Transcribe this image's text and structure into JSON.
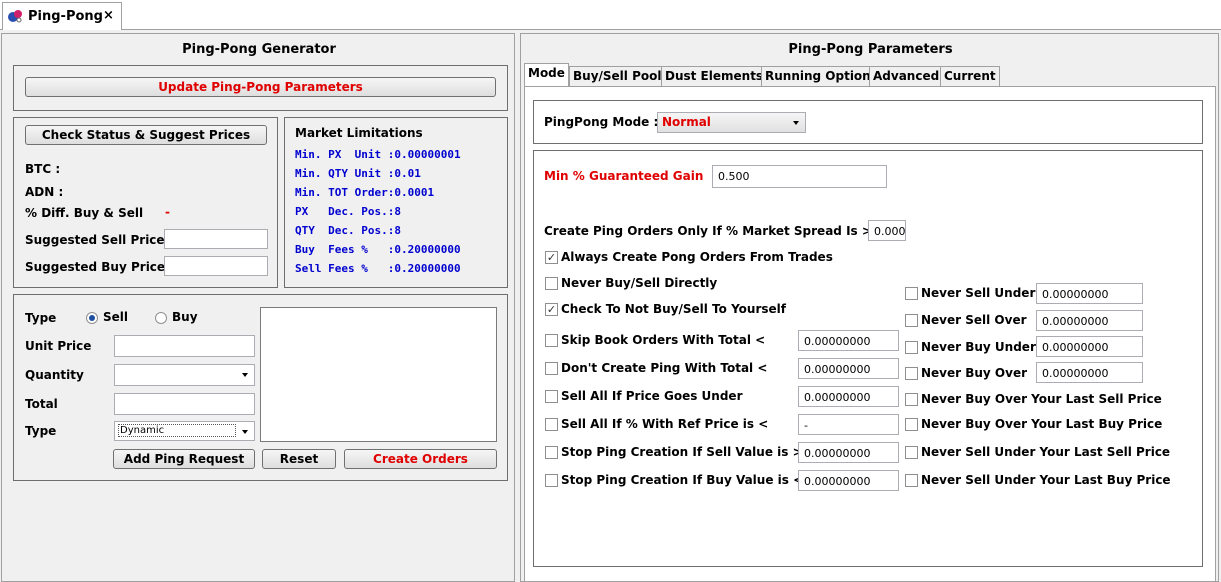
{
  "window": {
    "tab_title": "Ping-Pong",
    "tab_close": "×"
  },
  "generator": {
    "title": "Ping-Pong Generator",
    "update_button": "Update Ping-Pong Parameters",
    "check_status_button": "Check Status & Suggest Prices",
    "btc_label": "BTC :",
    "adn_label": "ADN :",
    "diff_label": "% Diff. Buy & Sell",
    "diff_value": "-",
    "suggested_sell_label": "Suggested Sell Price",
    "suggested_buy_label": "Suggested Buy Price",
    "market": {
      "title": "Market Limitations",
      "lines": [
        "Min. PX  Unit :0.00000001",
        "Min. QTY Unit :0.01",
        "Min. TOT Order:0.0001",
        "PX   Dec. Pos.:8",
        "QTY  Dec. Pos.:8",
        "Buy  Fees %   :0.20000000",
        "Sell Fees %   :0.20000000"
      ]
    },
    "order": {
      "type_label": "Type",
      "sell_label": "Sell",
      "buy_label": "Buy",
      "unit_price_label": "Unit Price",
      "quantity_label": "Quantity",
      "total_label": "Total",
      "type2_label": "Type",
      "type2_value": "Dynamic",
      "add_button": "Add Ping Request",
      "reset_button": "Reset",
      "create_button": "Create Orders"
    }
  },
  "params": {
    "title": "Ping-Pong Parameters",
    "tabs": [
      "Mode",
      "Buy/Sell Pool",
      "Dust Elements",
      "Running Option",
      "Advanced",
      "Current"
    ],
    "mode_label": "PingPong Mode :",
    "mode_value": "Normal",
    "min_gain_label": "Min % Guaranteed Gain",
    "min_gain_value": "0.500",
    "spread_label": "Create Ping Orders Only If % Market Spread Is >",
    "spread_value": "0.000",
    "left_checks": [
      {
        "label": "Always Create Pong Orders From Trades",
        "checked": "✓"
      },
      {
        "label": "Never Buy/Sell Directly",
        "checked": ""
      },
      {
        "label": "Check To Not Buy/Sell To Yourself",
        "checked": "✓"
      },
      {
        "label": "Skip Book Orders With Total <",
        "checked": "",
        "value": "0.00000000"
      },
      {
        "label": "Don't Create Ping With Total <",
        "checked": "",
        "value": "0.00000000"
      },
      {
        "label": "Sell All If Price Goes Under",
        "checked": "",
        "value": "0.00000000"
      },
      {
        "label": "Sell All If % With Ref Price is <",
        "checked": "",
        "value": "-"
      },
      {
        "label": "Stop Ping Creation If Sell Value is >",
        "checked": "",
        "value": "0.00000000"
      },
      {
        "label": "Stop Ping Creation If Buy Value is <",
        "checked": "",
        "value": "0.00000000"
      }
    ],
    "right_checks": [
      {
        "label": "Never Sell Under",
        "value": "0.00000000"
      },
      {
        "label": "Never Sell Over",
        "value": "0.00000000"
      },
      {
        "label": "Never Buy Under",
        "value": "0.00000000"
      },
      {
        "label": "Never Buy Over",
        "value": "0.00000000"
      },
      {
        "label": "Never Buy Over Your Last Sell Price"
      },
      {
        "label": "Never Buy Over Your Last Buy Price"
      },
      {
        "label": "Never Sell Under Your Last Sell Price"
      },
      {
        "label": "Never Sell Under Your Last Buy Price"
      }
    ]
  }
}
